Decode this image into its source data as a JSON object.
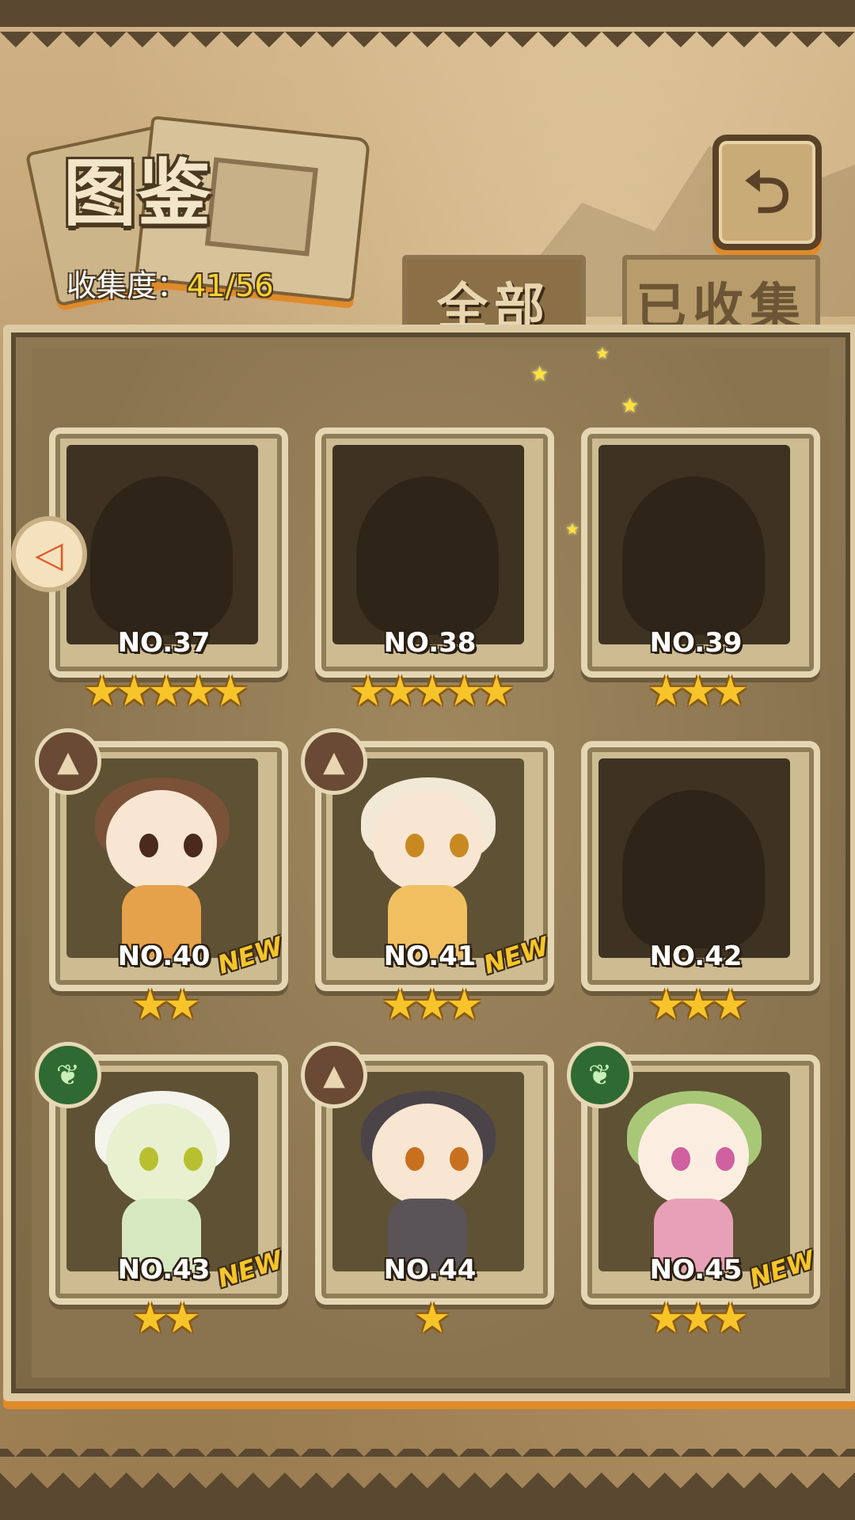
{
  "header": {
    "title": "图鉴",
    "collection_label": "收集度：",
    "collection_value": "41/56",
    "back_icon": "return-arrow-icon"
  },
  "tabs": [
    {
      "label": "全部",
      "active": true
    },
    {
      "label": "已收集",
      "active": false
    }
  ],
  "cards": [
    {
      "number": "NO.37",
      "stars": "★★★★★",
      "locked": true,
      "new": "",
      "element": ""
    },
    {
      "number": "NO.38",
      "stars": "★★★★★",
      "locked": true,
      "new": "",
      "element": ""
    },
    {
      "number": "NO.39",
      "stars": "★★★",
      "locked": true,
      "new": "",
      "element": ""
    },
    {
      "number": "NO.40",
      "stars": "★★",
      "locked": false,
      "new": "NEW",
      "element": "mountain"
    },
    {
      "number": "NO.41",
      "stars": "★★★",
      "locked": false,
      "new": "NEW",
      "element": "mountain"
    },
    {
      "number": "NO.42",
      "stars": "★★★",
      "locked": true,
      "new": "",
      "element": ""
    },
    {
      "number": "NO.43",
      "stars": "★★",
      "locked": false,
      "new": "NEW",
      "element": "leaf"
    },
    {
      "number": "NO.44",
      "stars": "★",
      "locked": false,
      "new": "",
      "element": "mountain"
    },
    {
      "number": "NO.45",
      "stars": "★★★",
      "locked": false,
      "new": "NEW",
      "element": "leaf"
    }
  ],
  "colors": {
    "accent_orange": "#e08a2a",
    "star_yellow": "#f7c52a",
    "frame_dark": "#5a4228"
  }
}
